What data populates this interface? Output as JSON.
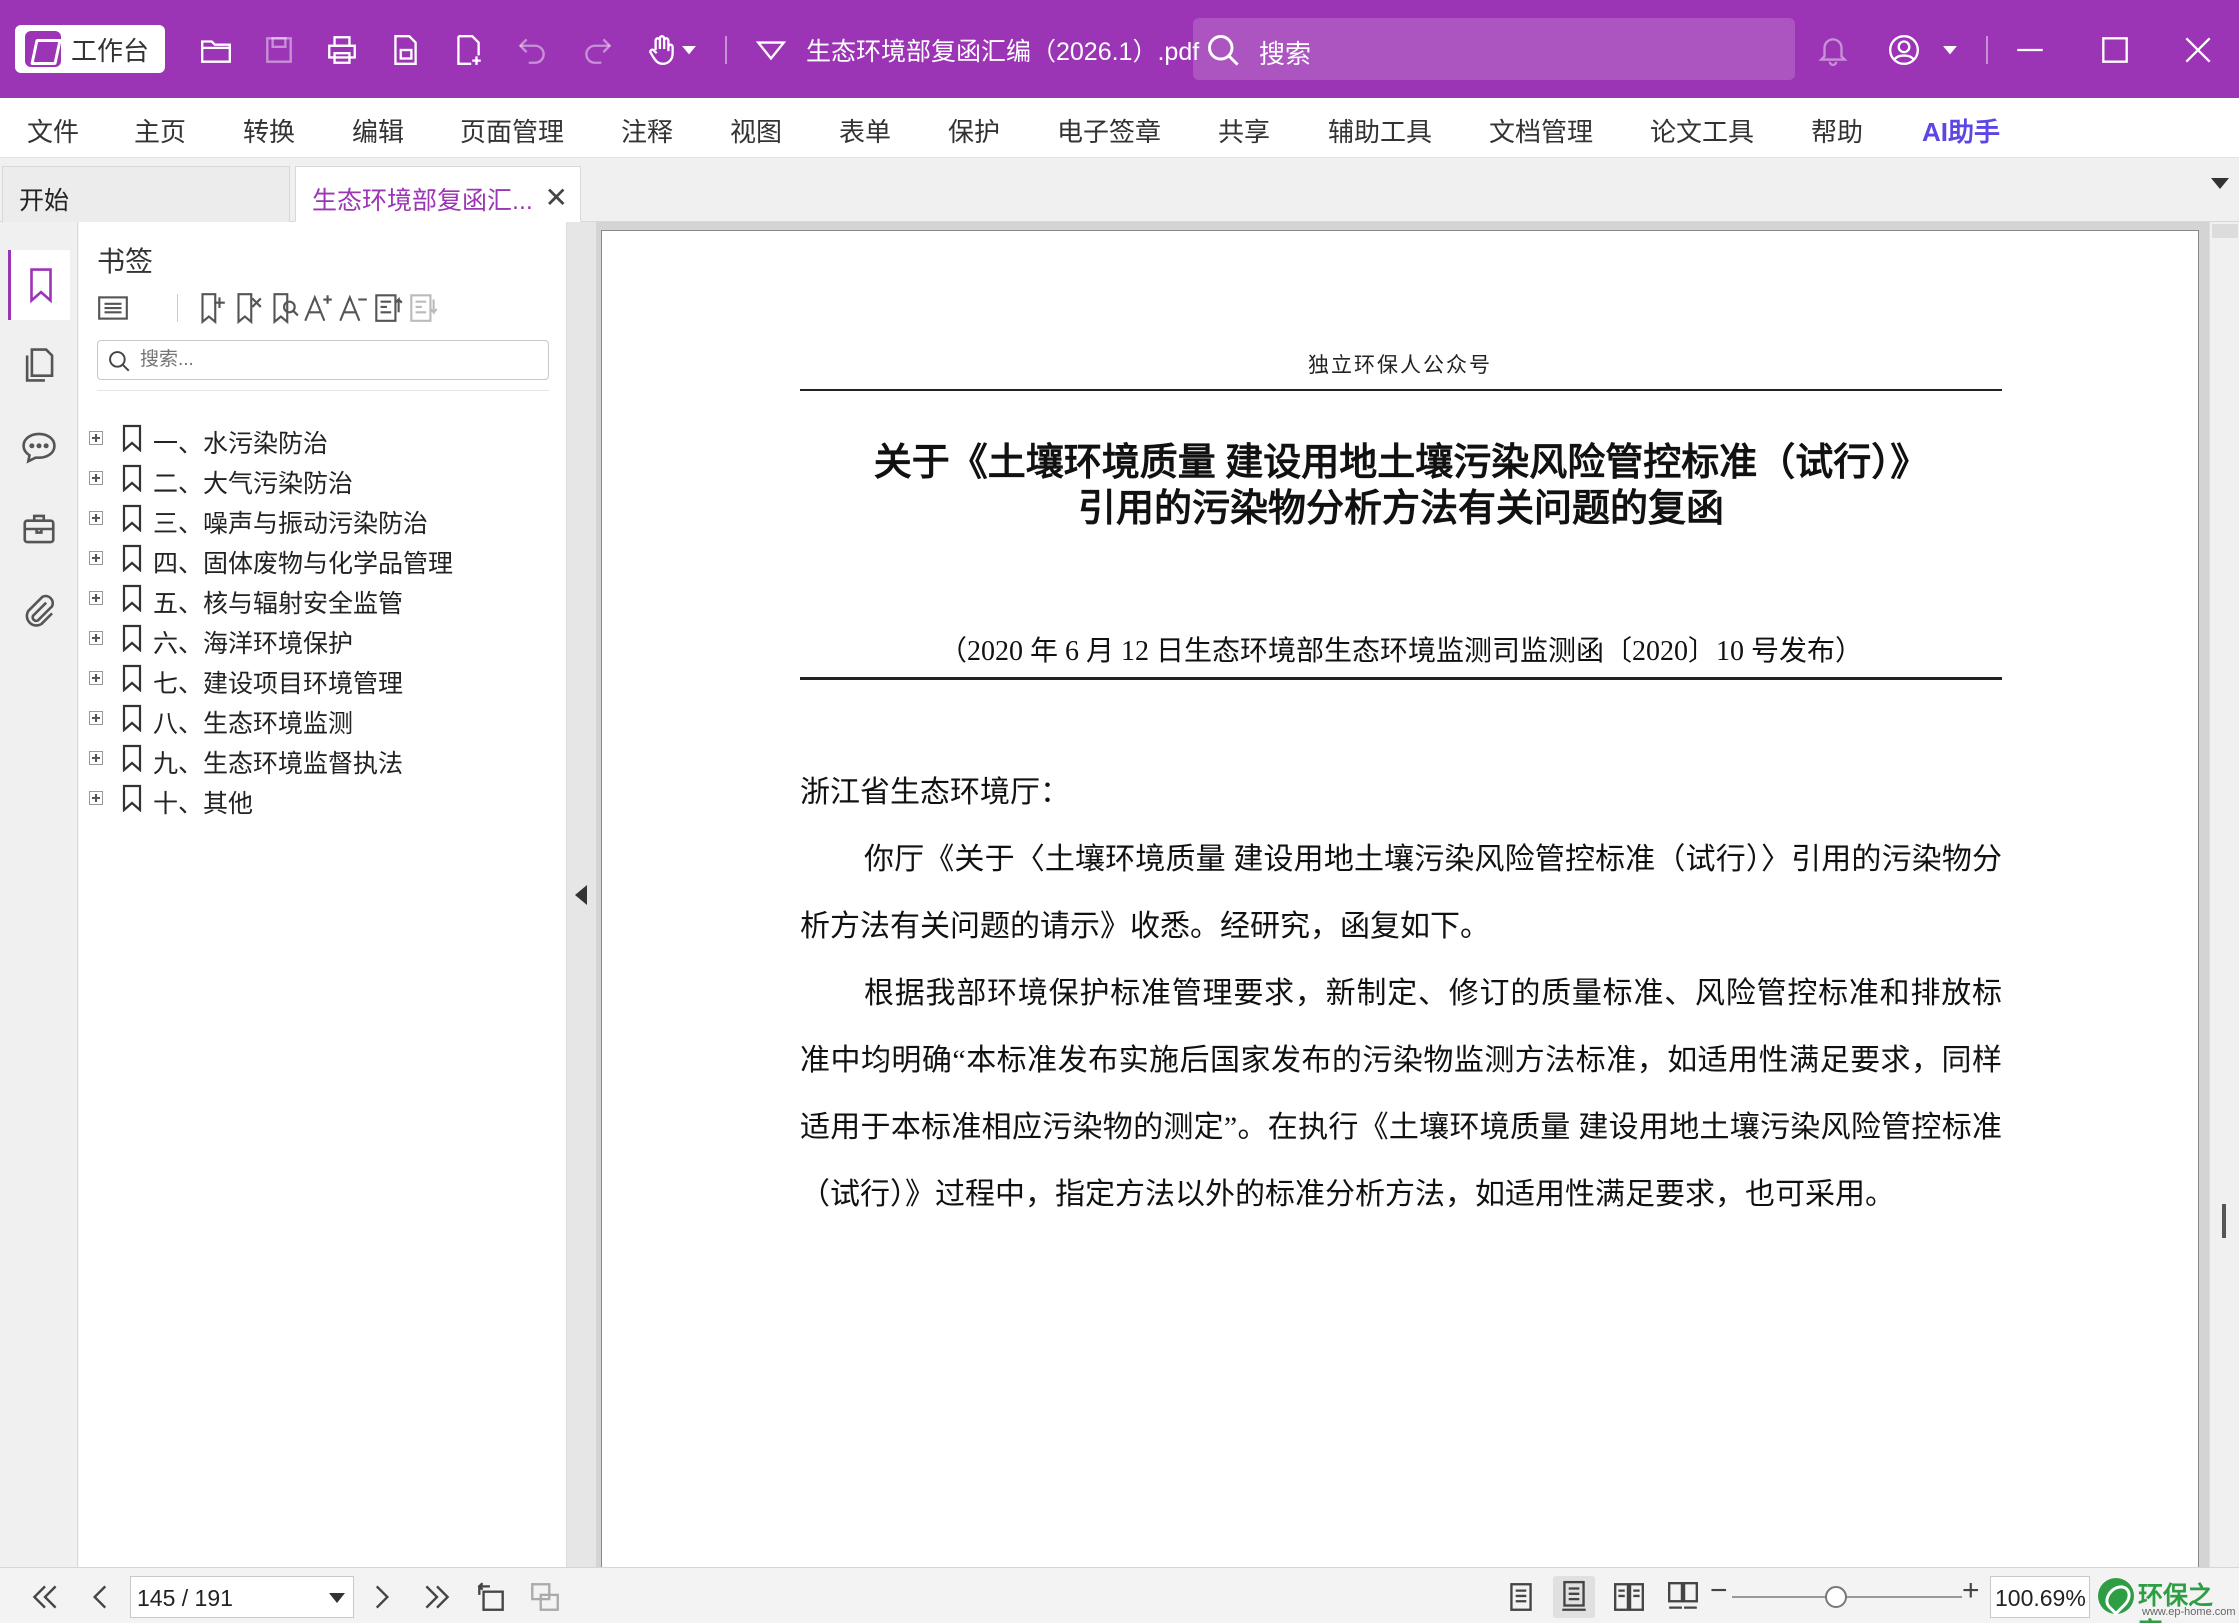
{
  "titlebar": {
    "workbench_label": "工作台",
    "document_title": "生态环境部复函汇编（2026.1）.pdf",
    "search_placeholder": "搜索",
    "accent_color": "#9c35b5",
    "icons": [
      "open-folder-icon",
      "save-icon",
      "print-icon",
      "page-icon",
      "new-page-icon",
      "undo-icon",
      "redo-icon",
      "hand-tool-icon",
      "dropdown-icon",
      "bell-icon",
      "account-icon",
      "minimize-icon",
      "maximize-icon",
      "close-icon"
    ]
  },
  "menubar": {
    "items": [
      "文件",
      "主页",
      "转换",
      "编辑",
      "页面管理",
      "注释",
      "视图",
      "表单",
      "保护",
      "电子签章",
      "共享",
      "辅助工具",
      "文档管理",
      "论文工具",
      "帮助",
      "AI助手"
    ]
  },
  "tabs": {
    "home": "开始",
    "document": "生态环境部复函汇...",
    "close_symbol": "✕"
  },
  "sidebar": {
    "rail_icons": [
      "bookmark-icon",
      "pages-icon",
      "comment-icon",
      "toolbox-icon",
      "attachment-icon"
    ],
    "panel_title": "书签",
    "search_placeholder": "搜索...",
    "bookmarks": [
      {
        "label": "一、水污染防治"
      },
      {
        "label": "二、大气污染防治"
      },
      {
        "label": "三、噪声与振动污染防治"
      },
      {
        "label": "四、固体废物与化学品管理"
      },
      {
        "label": "五、核与辐射安全监管"
      },
      {
        "label": "六、海洋环境保护"
      },
      {
        "label": "七、建设项目环境管理"
      },
      {
        "label": "八、生态环境监测"
      },
      {
        "label": "九、生态环境监督执法"
      },
      {
        "label": "十、其他"
      }
    ]
  },
  "document": {
    "header": "独立环保人公众号",
    "title_line1": "关于《土壤环境质量  建设用地土壤污染风险管控标准（试行）》",
    "title_line2": "引用的污染物分析方法有关问题的复函",
    "subtitle": "（2020 年 6 月 12 日生态环境部生态环境监测司监测函〔2020〕10 号发布）",
    "salutation": "浙江省生态环境厅：",
    "paragraph1": "你厅《关于〈土壤环境质量 建设用地土壤污染风险管控标准（试行）〉引用的污染物分析方法有关问题的请示》收悉。经研究，函复如下。",
    "paragraph2": "根据我部环境保护标准管理要求，新制定、修订的质量标准、风险管控标准和排放标准中均明确“本标准发布实施后国家发布的污染物监测方法标准，如适用性满足要求，同样适用于本标准相应污染物的测定”。在执行《土壤环境质量 建设用地土壤污染风险管控标准（试行）》过程中，指定方法以外的标准分析方法，如适用性满足要求，也可采用。"
  },
  "statusbar": {
    "page_indicator": "145 / 191",
    "zoom": "100.69%",
    "zoom_level_fraction": 0.45,
    "watermark_text": "环保之家",
    "watermark_url": "www.ep-home.com"
  }
}
